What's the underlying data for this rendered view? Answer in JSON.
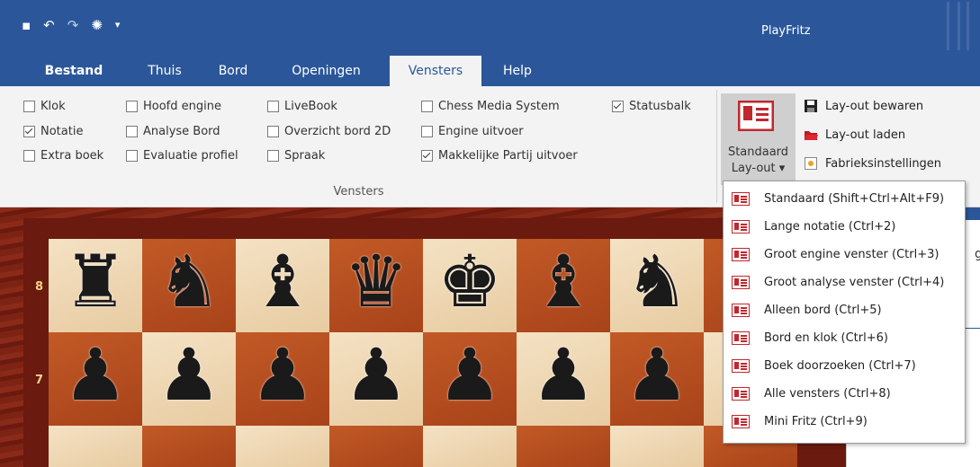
{
  "app": {
    "title": "PlayFritz"
  },
  "qat": {
    "save_icon": "▪",
    "undo_icon": "↶",
    "redo_icon": "↷",
    "engine_icon": "✺",
    "more_icon": "▾"
  },
  "tabs": [
    {
      "label": "Bestand"
    },
    {
      "label": "Thuis"
    },
    {
      "label": "Bord"
    },
    {
      "label": "Openingen"
    },
    {
      "label": "Vensters"
    },
    {
      "label": "Help"
    }
  ],
  "ribbon": {
    "group_label": "Vensters",
    "checkboxes": [
      {
        "label": "Klok",
        "checked": false
      },
      {
        "label": "Notatie",
        "checked": true
      },
      {
        "label": "Extra boek",
        "checked": false
      },
      {
        "label": "Hoofd engine",
        "checked": false
      },
      {
        "label": "Analyse Bord",
        "checked": false
      },
      {
        "label": "Evaluatie profiel",
        "checked": false
      },
      {
        "label": "LiveBook",
        "checked": false
      },
      {
        "label": "Overzicht bord 2D",
        "checked": false
      },
      {
        "label": "Spraak",
        "checked": false
      },
      {
        "label": "Chess Media System",
        "checked": false
      },
      {
        "label": "Engine uitvoer",
        "checked": false
      },
      {
        "label": "Makkelijke Partij uitvoer",
        "checked": true
      },
      {
        "label": "Statusbalk",
        "checked": true
      }
    ],
    "standard_layout": {
      "line1": "Standaard",
      "line2": "Lay-out ▾"
    },
    "layout_actions": [
      {
        "label": "Lay-out bewaren"
      },
      {
        "label": "Lay-out laden"
      },
      {
        "label": "Fabrieksinstellingen"
      }
    ]
  },
  "board": {
    "ranks": [
      "8",
      "7"
    ],
    "rank8": [
      "♜",
      "♞",
      "♝",
      "♛",
      "♚",
      "♝",
      "♞"
    ],
    "rank7": [
      "♟",
      "♟",
      "♟",
      "♟",
      "♟",
      "♟",
      "♟"
    ]
  },
  "right_panel": {
    "glyph": "g"
  },
  "menu": {
    "items": [
      {
        "label": "Standaard (Shift+Ctrl+Alt+F9)"
      },
      {
        "label": "Lange notatie (Ctrl+2)"
      },
      {
        "label": "Groot engine venster (Ctrl+3)"
      },
      {
        "label": "Groot analyse venster (Ctrl+4)"
      },
      {
        "label": "Alleen bord (Ctrl+5)"
      },
      {
        "label": "Bord en klok (Ctrl+6)"
      },
      {
        "label": "Boek doorzoeken (Ctrl+7)"
      },
      {
        "label": "Alle vensters (Ctrl+8)"
      },
      {
        "label": "Mini Fritz (Ctrl+9)"
      }
    ]
  },
  "colors": {
    "accent": "#2b579a",
    "layout_icon": "#c0272d"
  }
}
